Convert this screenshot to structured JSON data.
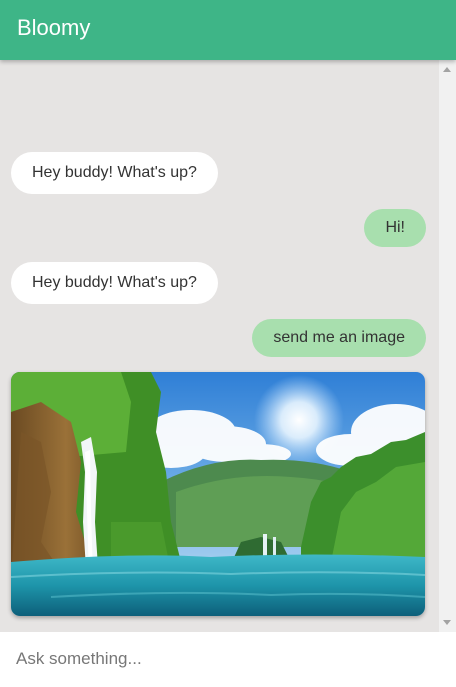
{
  "app": {
    "title": "Bloomy"
  },
  "messages": [
    {
      "from": "bot",
      "text": "Hey buddy! What's up?"
    },
    {
      "from": "user",
      "text": "Hi!"
    },
    {
      "from": "bot",
      "text": "Hey buddy! What's up?"
    },
    {
      "from": "user",
      "text": "send me an image"
    },
    {
      "from": "bot",
      "type": "image",
      "description": ""
    }
  ],
  "input": {
    "placeholder": "Ask something..."
  },
  "colors": {
    "header": "#3eb587",
    "chat_bg": "#e6e4e3",
    "user_bubble": "#a8dfae",
    "bot_bubble": "#ffffff"
  }
}
